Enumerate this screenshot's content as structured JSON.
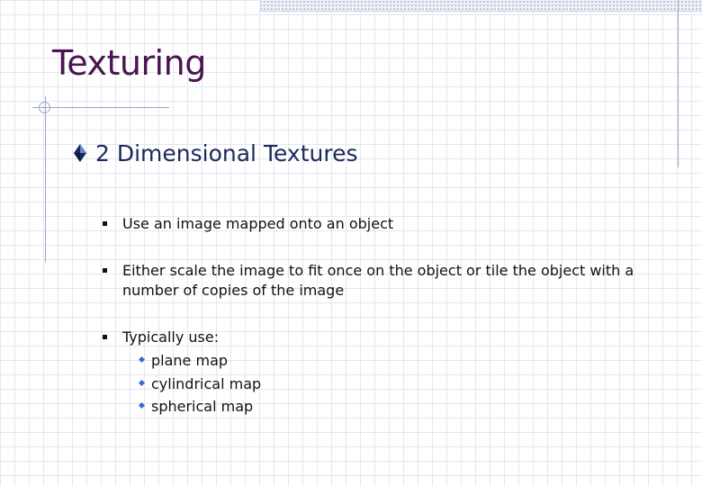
{
  "slide": {
    "title": "Texturing",
    "heading": "2 Dimensional Textures",
    "items": [
      "Use an image mapped onto an object",
      "Either scale the image to fit once on the object or tile the object with a",
      "number of copies of the image",
      "Typically use:"
    ],
    "subitems": [
      "plane map",
      "cylindrical map",
      "spherical map"
    ],
    "colors": {
      "title": "#4a1450",
      "heading": "#1a2a5a",
      "sub_bullet": "#3a6bd0",
      "rule": "#9aa7c8"
    }
  }
}
